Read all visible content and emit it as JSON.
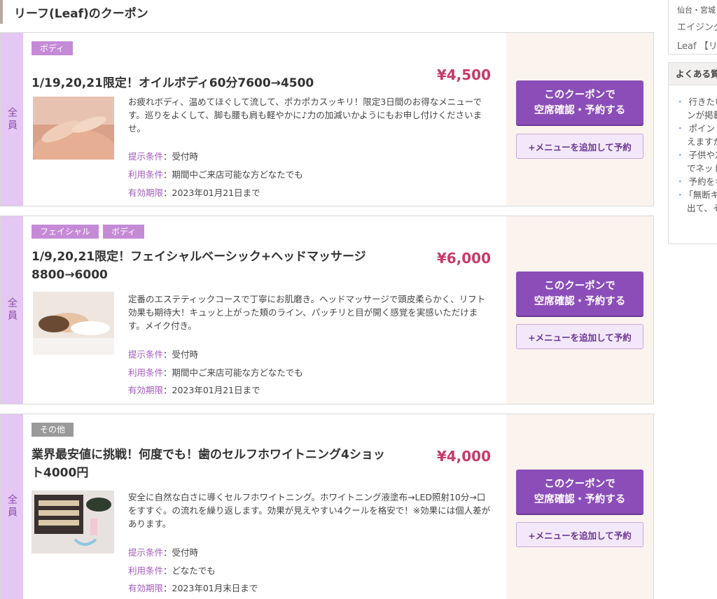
{
  "page": {
    "title": "リーフ(Leaf)のクーポン"
  },
  "common": {
    "side_tag": "全員",
    "btn_primary_line1": "このクーポンで",
    "btn_primary_line2": "空席確認・予約する",
    "btn_secondary": "+メニューを追加して予約",
    "cond_present_label": "提示条件",
    "cond_use_label": "利用条件",
    "cond_valid_label": "有効期限"
  },
  "coupons": [
    {
      "tags": [
        "ボディ"
      ],
      "title": "1/19,20,21限定！オイルボディ60分7600→4500",
      "price": "¥4,500",
      "description": "お疲れボディ、温めてほぐして流して、ポカポカスッキリ！限定3日間のお得なメニューです。巡りをよくして、脚も腰も肩も軽やかに♪力の加減いかようにもお申し付けくださいませ。",
      "cond_present": "：受付時",
      "cond_use": "：期間中ご来店可能な方どなたでも",
      "cond_valid": "：2023年01月21日まで"
    },
    {
      "tags": [
        "フェイシャル",
        "ボディ"
      ],
      "title": "1/9,20,21限定！フェイシャルベーシック+ヘッドマッサージ8800→6000",
      "price": "¥6,000",
      "description": "定番のエステティックコースで丁寧にお肌磨き。ヘッドマッサージで頭皮柔らかく、リフト効果も期待大！キュッと上がった頬のライン、パッチリと目が開く感覚を実感いただけます。メイク付き。",
      "cond_present": "：受付時",
      "cond_use": "：期間中ご来店可能な方どなたでも",
      "cond_valid": "：2023年01月21日まで"
    },
    {
      "tags": [
        "その他"
      ],
      "title": "業界最安値に挑戦！何度でも！歯のセルフホワイトニング4ショット4000円",
      "price": "¥4,000",
      "description": "安全に自然な白さに導くセルフホワイトニング。ホワイトニング液塗布→LED照射10分→口をすすぐ。の流れを繰り返します。効果が見えやすい4クールを格安で！※効果には個人差があります。",
      "cond_present": "：受付時",
      "cond_use": "：どなたでも",
      "cond_valid": "：2023年01月末日まで"
    }
  ],
  "sidebar": {
    "area": "仙台・宮城",
    "line1": "エイジング",
    "line2": "Leaf 【リ",
    "faq_heading": "よくある質",
    "faq_items": [
      "行きたい",
      "ンが掲載",
      "ポイント",
      "えますか",
      "子供や友",
      "でネット",
      "予約をキ",
      "「無断キ",
      "出て、そ"
    ]
  }
}
